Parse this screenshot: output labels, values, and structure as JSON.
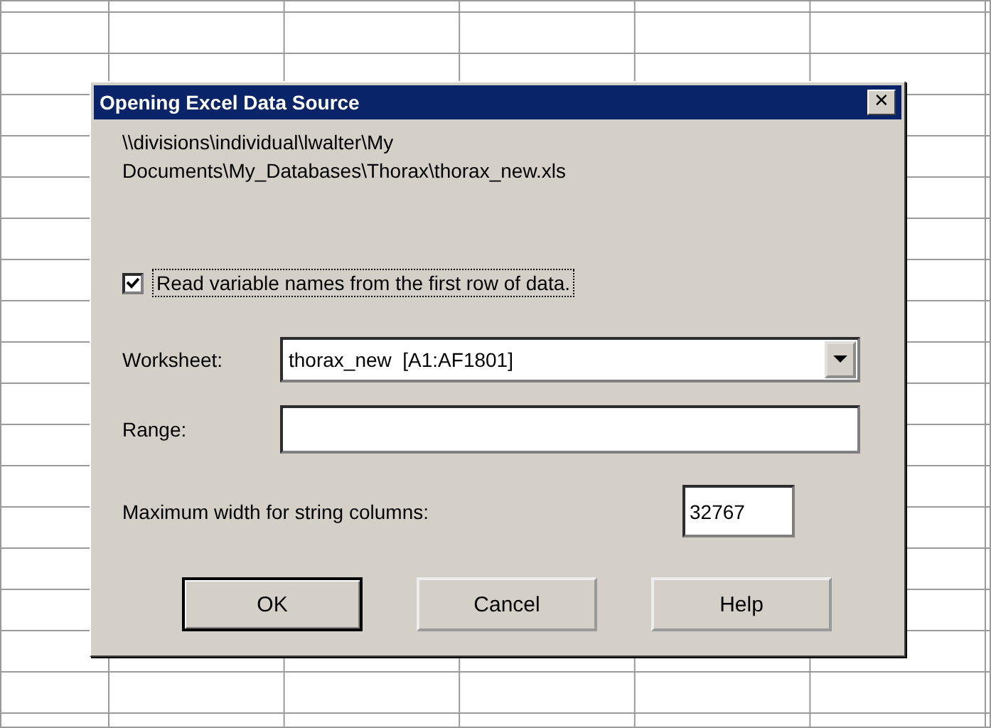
{
  "window": {
    "title": "Opening Excel Data Source",
    "close": "✕"
  },
  "path": "\\\\divisions\\individual\\lwalter\\My Documents\\My_Databases\\Thorax\\thorax_new.xls",
  "checkbox": {
    "label": "Read variable names from the first row of data.",
    "checked": true,
    "focused": true
  },
  "worksheet": {
    "label": "Worksheet:",
    "value": "thorax_new  [A1:AF1801]"
  },
  "range": {
    "label": "Range:"
  },
  "max_width": {
    "label": "Maximum width for string columns:",
    "value": "32767"
  },
  "buttons": [
    {
      "label": "OK",
      "default": true
    },
    {
      "label": "Cancel",
      "default": false
    },
    {
      "label": "Help",
      "default": false
    }
  ]
}
